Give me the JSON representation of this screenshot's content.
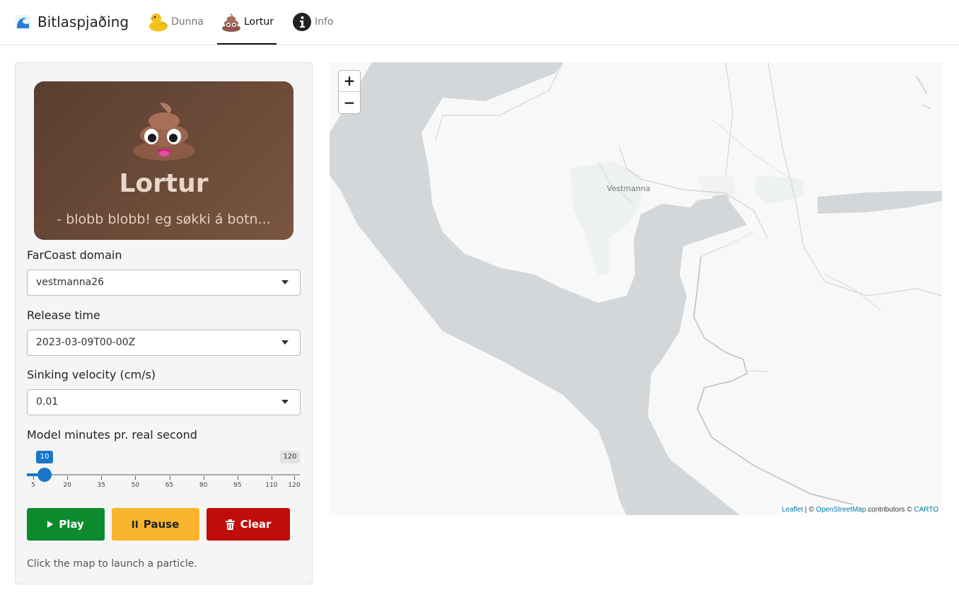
{
  "navbar": {
    "brand_title": "Bitlaspjaðing",
    "tabs": [
      {
        "label": "Dunna",
        "icon": "duck-icon"
      },
      {
        "label": "Lortur",
        "icon": "poop-icon",
        "active": true
      },
      {
        "label": "Info",
        "icon": "info-icon"
      }
    ]
  },
  "hero": {
    "title": "Lortur",
    "subtitle": "- blobb blobb! eg søkki á botn..."
  },
  "controls": {
    "domain": {
      "label": "FarCoast domain",
      "value": "vestmanna26"
    },
    "release_time": {
      "label": "Release time",
      "value": "2023-03-09T00-00Z"
    },
    "sinking_velocity": {
      "label": "Sinking velocity (cm/s)",
      "value": "0.01"
    },
    "speed_slider": {
      "label": "Model minutes pr. real second",
      "value": "10",
      "max_label": "120",
      "min": 5,
      "max": 120,
      "current": 10,
      "ticks": [
        "5",
        "20",
        "35",
        "50",
        "65",
        "80",
        "95",
        "110",
        "120"
      ]
    }
  },
  "buttons": {
    "play": "Play",
    "pause": "Pause",
    "clear": "Clear"
  },
  "hint": "Click the map to launch a particle.",
  "map": {
    "zoom_in": "+",
    "zoom_out": "−",
    "town_label": "Vestmanna",
    "attribution": {
      "leaflet": "Leaflet",
      "sep": " | © ",
      "osm": "OpenStreetMap",
      "contrib": " contributors © ",
      "carto": "CARTO"
    }
  },
  "colors": {
    "play": "#0d8a2d",
    "pause": "#f7b42c",
    "clear": "#c10c0c",
    "slider_accent": "#1976c9",
    "water": "#d4d7da",
    "land": "#f8f8f8"
  }
}
